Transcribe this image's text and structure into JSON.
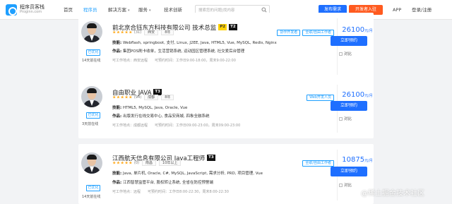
{
  "nav": {
    "logo_cn": "程序员客栈",
    "logo_en": "Proginn.com",
    "links": [
      "首页",
      "程序员",
      "解决方案",
      "服务",
      "技术创新"
    ],
    "search_placeholder": "搜索您的问题|找内容",
    "post_button": "发布需求",
    "dev_button": "开发者入驻",
    "app": "APP",
    "login": "登录/注册"
  },
  "cards": [
    {
      "title": "前北京合钰东方科技有限公司 技术总监",
      "level_p": "P2",
      "level_t": "T2",
      "rating_count": "(31)",
      "location": "西安",
      "experience": "8年",
      "badges": [
        "协作开发者",
        "全职/自由工作者"
      ],
      "skills_label": "技能:",
      "skills": "Webflash, springboot, 支付, Linux, J2EE, Java, HTML5, Vue, MySQL, Redis, Nginx",
      "works_label": "作品:",
      "works": "集团POS刷卡收单，生活营销系统, 运动园区管理系统, 社交爱后台管理",
      "available_work": "可工作地点：西安远程",
      "available_time": "可预约时间：工作日9:00-18:00，周末9:00-22:00",
      "online_tag": "已优化",
      "online_time": "14天前在线",
      "price": "26100",
      "price_unit": "元/月",
      "book": "立即预约",
      "compare": "对比"
    },
    {
      "title": "自由职业 JAVA",
      "level_t": "T3",
      "rating_count": "(94)",
      "location": "成都",
      "experience": "8年",
      "badges": [
        "Web开发人员"
      ],
      "skills_label": "技能:",
      "skills": "HTML5, MySQL, Java, Oracle, Vue",
      "works_label": "作品:",
      "works": "出版发行在线交易中心, 食品安商城, 四象全融系统",
      "available_work": "可工作地点：成都远程",
      "available_time": "可预约时间：工作日09:00-23:00，周末09:00-23:00",
      "online_tag": "已优化",
      "online_time": "3天前在线",
      "price": "26100",
      "price_unit": "元/月",
      "book": "立即预约",
      "compare": "对比"
    },
    {
      "title": "江西航天信息有限公司 Java工程师",
      "level_t": "T3",
      "rating_count": "(0)",
      "location": "南昌",
      "experience": "10年以上",
      "badges": [
        "全职/自由工作者"
      ],
      "skills_label": "技能:",
      "skills": "Java, 单片机, Oracle, C#, MySQL, JavaScript, 需求分析, PRD, 项目管理, Vue",
      "works_label": "作品:",
      "works": "江西智慧监管平台, 股权转让系统, 全省在防控预警端",
      "available_work": "可工作地点：远程",
      "available_time": "可预约时间：工作日8:00-22:30，周末8:00-22:30",
      "online_tag": "已优化",
      "online_time": "14天前在线",
      "price": "10875",
      "price_unit": "元/月",
      "book": "立即预约",
      "compare": "对比"
    }
  ],
  "watermark": "@稀土掘金技术社区",
  "colors": {
    "accent": "#1e6fff",
    "orange": "#ff5a1f",
    "star": "#ffaa1f"
  }
}
